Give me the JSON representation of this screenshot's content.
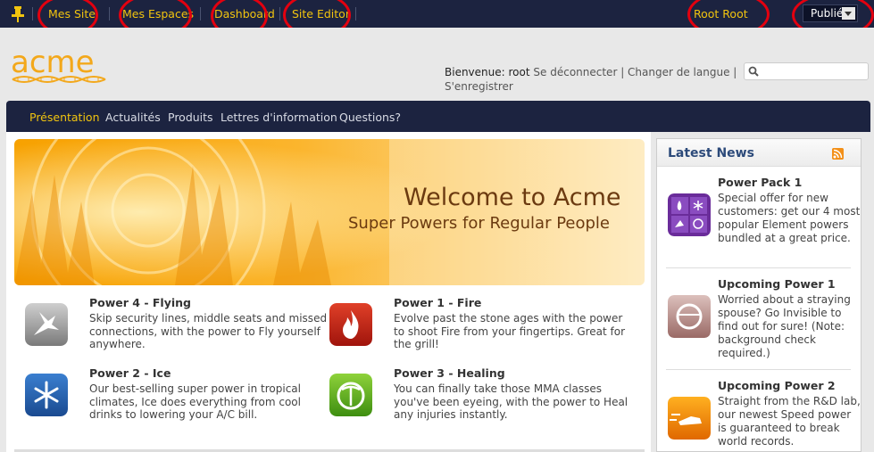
{
  "topbar": {
    "items": [
      "Mes Site",
      "Mes Espaces",
      "Dashboard",
      "Site Editor"
    ],
    "user": "Root Root",
    "status": "Publié"
  },
  "header": {
    "welcome_label": "Bienvenue:",
    "username": "root",
    "logout": "Se déconnecter",
    "change_language": "Changer de langue",
    "register": "S'enregistrer",
    "search_placeholder": "",
    "logo_text": "acme"
  },
  "nav": {
    "items": [
      "Présentation",
      "Actualités",
      "Produits",
      "Lettres d'information",
      "Questions?"
    ]
  },
  "banner": {
    "title": "Welcome to Acme",
    "subtitle": "Super Powers for Regular People"
  },
  "powers": [
    {
      "title": "Power 4 - Flying",
      "desc": "Skip security lines, middle seats and missed connections, with the power to Fly yourself anywhere.",
      "icon": "bird-icon"
    },
    {
      "title": "Power 1 - Fire",
      "desc": "Evolve past the stone ages with the power to shoot Fire from your fingertips. Great for the grill!",
      "icon": "flame-icon"
    },
    {
      "title": "Power 2 - Ice",
      "desc": "Our best-selling super power in tropical climates, Ice does everything from cool drinks to lowering your A/C bill.",
      "icon": "snowflake-icon"
    },
    {
      "title": "Power 3 - Healing",
      "desc": "You can finally take those MMA classes you've been eyeing, with the power to Heal any injuries instantly.",
      "icon": "caduceus-icon"
    }
  ],
  "sidebar": {
    "title": "Latest News",
    "news": [
      {
        "title": "Power Pack 1",
        "desc": "Special offer for new customers: get our 4 most popular Element powers bundled at a great price.",
        "icon": "power-pack-icon"
      },
      {
        "title": "Upcoming Power 1",
        "desc": "Worried about a straying spouse? Go Invisible to find out for sure! (Note: background check required.)",
        "icon": "invisible-icon"
      },
      {
        "title": "Upcoming Power 2",
        "desc": "Straight from the R&D lab, our newest Speed power is guaranteed to break world records.",
        "icon": "speed-icon"
      }
    ]
  },
  "colors": {
    "topbar": "#1c2340",
    "accent": "#f1c40f",
    "annotation": "#e3000f"
  }
}
